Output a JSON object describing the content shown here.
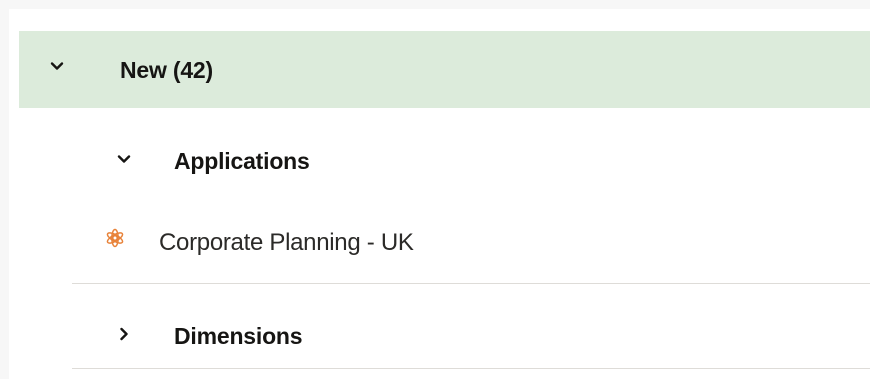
{
  "tree": {
    "group": {
      "label": "New (42)",
      "expanded": true,
      "background_color": "#dcebdb"
    },
    "sections": [
      {
        "label": "Applications",
        "expanded": true,
        "items": [
          {
            "label": "Corporate Planning - UK",
            "icon": "application-flower-icon",
            "icon_color": "#e8833a"
          }
        ]
      },
      {
        "label": "Dimensions",
        "expanded": false
      }
    ]
  }
}
